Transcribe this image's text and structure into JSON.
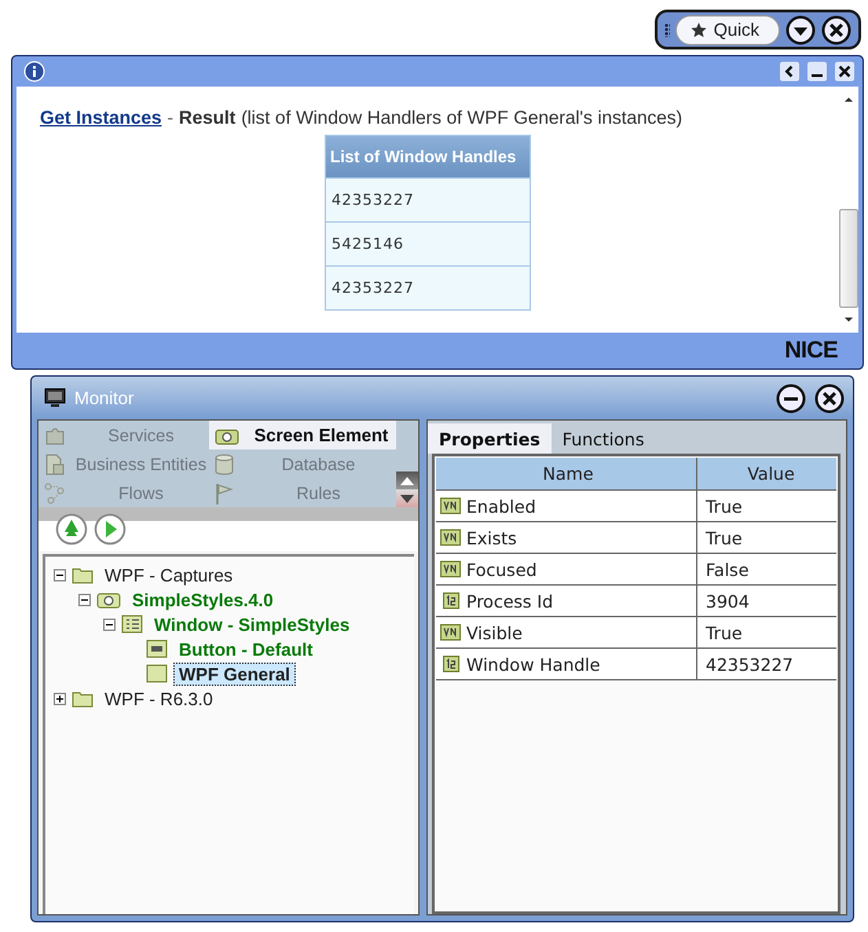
{
  "quick_bar": {
    "button": "Quick"
  },
  "info_window": {
    "link": "Get Instances",
    "separator": "-",
    "heading": "Result",
    "description": "(list of Window Handlers of WPF General's instances)",
    "table": {
      "column": "List of Window Handles",
      "rows": [
        "42353227",
        "5425146",
        "42353227"
      ]
    },
    "logo": "NICE"
  },
  "monitor": {
    "title": "Monitor",
    "sections": [
      {
        "label": "Services",
        "kind": "services",
        "selected": false
      },
      {
        "label": "Screen Element",
        "kind": "screen",
        "selected": true
      },
      {
        "label": "Business Entities",
        "kind": "entities",
        "selected": false
      },
      {
        "label": "Database",
        "kind": "database",
        "selected": false
      },
      {
        "label": "Flows",
        "kind": "flows",
        "selected": false
      },
      {
        "label": "Rules",
        "kind": "rules",
        "selected": false
      }
    ],
    "tree": [
      {
        "label": "WPF - Captures",
        "kind": "folder",
        "expanded": true,
        "captured": false,
        "selected": false,
        "children": [
          {
            "label": "SimpleStyles.4.0",
            "kind": "camera",
            "expanded": true,
            "captured": true,
            "selected": false,
            "children": [
              {
                "label": "Window - SimpleStyles",
                "kind": "window",
                "expanded": true,
                "captured": true,
                "selected": false,
                "children": [
                  {
                    "label": "Button - Default",
                    "kind": "button",
                    "captured": true,
                    "selected": false
                  },
                  {
                    "label": "WPF General",
                    "kind": "element",
                    "captured": false,
                    "selected": true
                  }
                ]
              }
            ]
          }
        ]
      },
      {
        "label": "WPF - R6.3.0",
        "kind": "folder",
        "expanded": false,
        "captured": false,
        "selected": false
      }
    ],
    "tabs": [
      {
        "label": "Properties",
        "selected": true
      },
      {
        "label": "Functions",
        "selected": false
      }
    ],
    "columns": [
      "Name",
      "Value"
    ],
    "properties": [
      {
        "name": "Enabled",
        "kind": "boolean",
        "value": "True"
      },
      {
        "name": "Exists",
        "kind": "boolean",
        "value": "True"
      },
      {
        "name": "Focused",
        "kind": "boolean",
        "value": "False"
      },
      {
        "name": "Process Id",
        "kind": "number",
        "value": "3904"
      },
      {
        "name": "Visible",
        "kind": "boolean",
        "value": "True"
      },
      {
        "name": "Window Handle",
        "kind": "number",
        "value": "42353227"
      }
    ]
  }
}
